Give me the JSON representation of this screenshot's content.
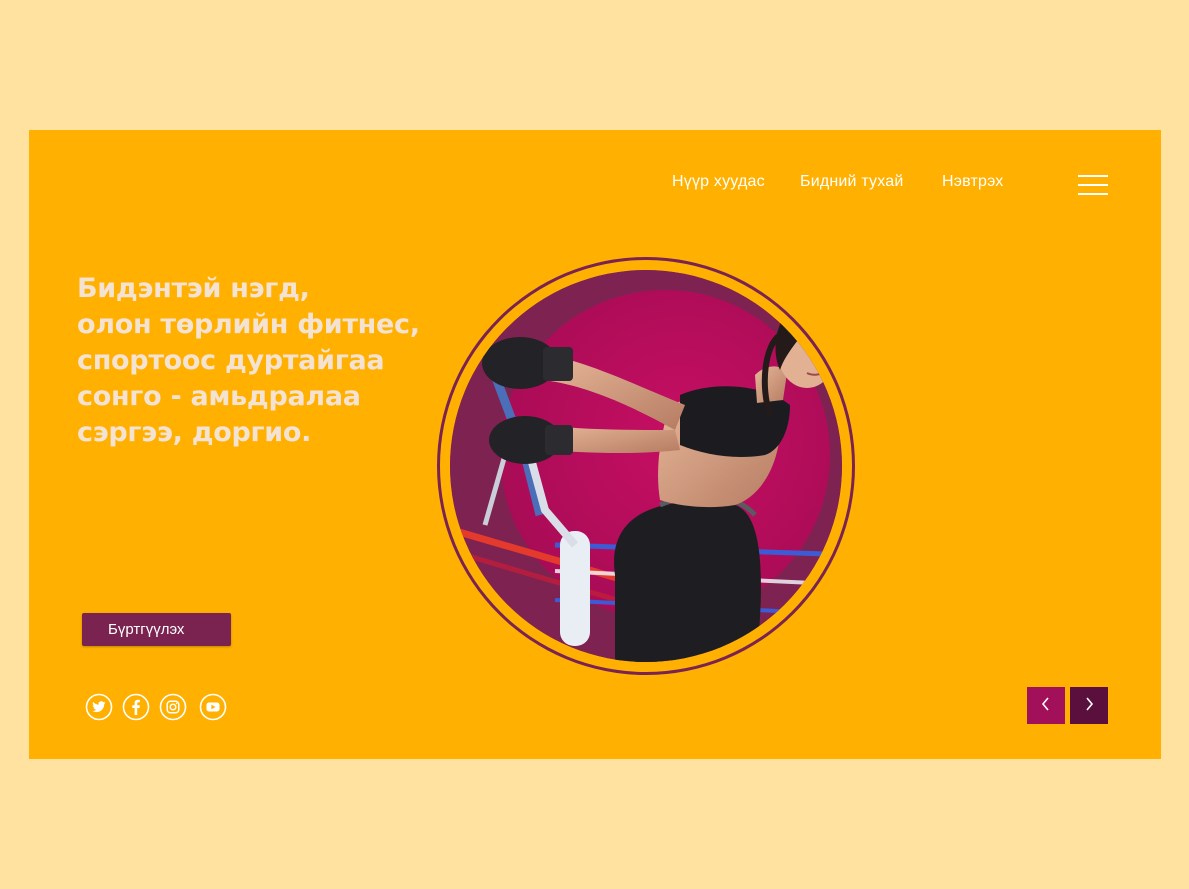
{
  "nav": {
    "items": [
      {
        "label": "Нүүр хуудас"
      },
      {
        "label": "Бидний тухай"
      },
      {
        "label": "Нэвтрэх"
      }
    ],
    "menu_icon": "hamburger-menu-icon"
  },
  "hero": {
    "headline_lines": [
      "Бидэнтэй нэгд,",
      "олон төрлийн фитнес,",
      "спортоос дуртайгаа",
      "сонго - амьдралаа",
      "сэргээ, доргио."
    ],
    "register_label": "Бүртгүүлэх"
  },
  "social": {
    "icons": [
      "twitter-icon",
      "facebook-icon",
      "instagram-icon",
      "youtube-icon"
    ]
  },
  "carousel": {
    "prev_icon": "chevron-left-icon",
    "next_icon": "chevron-right-icon"
  },
  "colors": {
    "page_bg": "#FFE1A0",
    "hero_bg": "#FFB000",
    "accent_plum": "#7A2350",
    "magenta": "#A3105A",
    "dark_plum": "#5A0F3C",
    "headline_text": "#F4E2D2"
  }
}
